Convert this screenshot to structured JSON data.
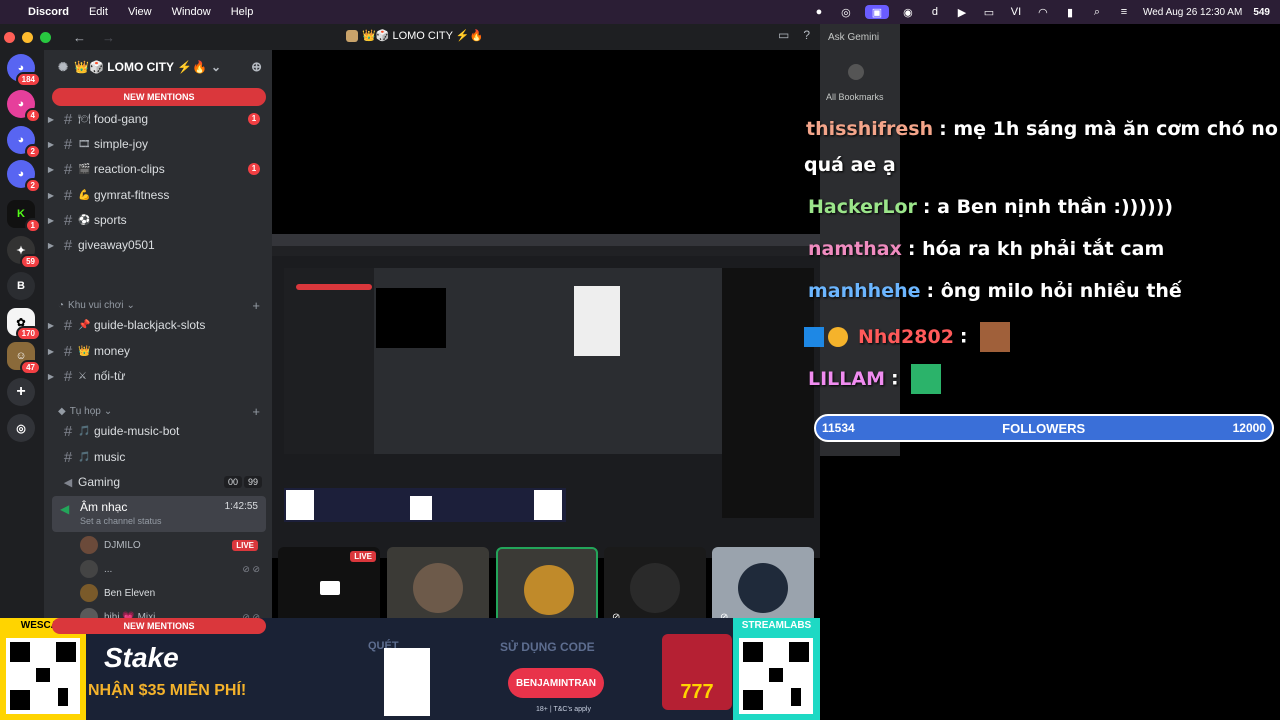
{
  "menubar": {
    "app": "Discord",
    "items": [
      "Edit",
      "View",
      "Window",
      "Help"
    ],
    "clock": "Wed Aug 26 12:30 AM",
    "viewer_count": "549"
  },
  "window": {
    "title": "👑🎲 LOMO CITY ⚡🔥"
  },
  "rail": {
    "badges": [
      "184",
      "4",
      "2",
      "2",
      "1",
      "59",
      "170",
      "47"
    ],
    "letter_server": "B"
  },
  "sidebar": {
    "server_name": "👑🎲 LOMO CITY ⚡🔥",
    "mentions_label": "NEW MENTIONS",
    "channels_top": [
      {
        "emoji": "🍽",
        "name": "food-gang",
        "unread": "1"
      },
      {
        "emoji": "🎞",
        "name": "simple-joy",
        "unread": ""
      },
      {
        "emoji": "🎬",
        "name": "reaction-clips",
        "unread": "1"
      },
      {
        "emoji": "💪",
        "name": "gymrat-fitness",
        "unread": ""
      },
      {
        "emoji": "⚽",
        "name": "sports",
        "unread": ""
      },
      {
        "emoji": "",
        "name": "giveaway0501",
        "unread": ""
      }
    ],
    "category_fun": "Khu vui chơi",
    "channels_fun": [
      {
        "emoji": "📌",
        "name": "guide-blackjack-slots"
      },
      {
        "emoji": "👑",
        "name": "money"
      },
      {
        "emoji": "⚔",
        "name": "nối-từ"
      }
    ],
    "category_meet": "Tụ họp",
    "channels_meet": [
      {
        "emoji": "🎵",
        "name": "guide-music-bot"
      },
      {
        "emoji": "🎵",
        "name": "music"
      }
    ],
    "gaming": {
      "name": "Gaming",
      "count_a": "00",
      "count_b": "99"
    },
    "active_voice": {
      "name": "Âm nhạc",
      "status": "Set a channel status",
      "time": "1:42:55"
    },
    "voice_users": [
      {
        "name": "DJMILO",
        "live": "LIVE"
      },
      {
        "name": "...",
        "live": ""
      },
      {
        "name": "Ben Eleven",
        "live": ""
      },
      {
        "name": "hihi 💗 Mixi",
        "live": ""
      }
    ],
    "mentions_bottom": "NEW MENTIONS"
  },
  "stage": {
    "tile_live": "LIVE"
  },
  "bookmarks": {
    "gemini": "Ask Gemini",
    "all": "All Bookmarks"
  },
  "chat": {
    "messages": [
      {
        "user": "thisshifresh",
        "sep": ":",
        "text": "mẹ 1h sáng mà ăn cơm chó no",
        "color": "#f4a58a"
      },
      {
        "user": "",
        "sep": "",
        "text": "quá ae ạ",
        "color": "#ffffff"
      },
      {
        "user": "HackerLor",
        "sep": ":",
        "text": "a Ben nịnh thần :))))))",
        "color": "#9be58a"
      },
      {
        "user": "namthax",
        "sep": ":",
        "text": "hóa ra kh phải tắt cam",
        "color": "#f08cc0"
      },
      {
        "user": "manhhehe",
        "sep": ":",
        "text": "ông milo hỏi nhiều thế",
        "color": "#6cb6ff"
      },
      {
        "user": "Nhd2802",
        "sep": ":",
        "text": "",
        "color": "#ff5a5a"
      },
      {
        "user": "LILLAM",
        "sep": ":",
        "text": "",
        "color": "#f08cf0"
      }
    ]
  },
  "followers": {
    "current": "11534",
    "label": "FOLLOWERS",
    "goal": "12000",
    "progress": 0.9612
  },
  "banner": {
    "left_tag": "WESCAN",
    "right_tag": "STREAMLABS",
    "brand": "Stake",
    "promo": "NHẬN $35 MIỄN PHÍ!",
    "scan": "QUÉT",
    "use_code": "SỬ DỤNG CODE",
    "code": "BENJAMINTRAN",
    "tnc": "18+ | T&C's apply",
    "slot": "777"
  },
  "colors": {
    "accent": "#5865f2",
    "danger": "#da373c",
    "online": "#23a55a"
  }
}
